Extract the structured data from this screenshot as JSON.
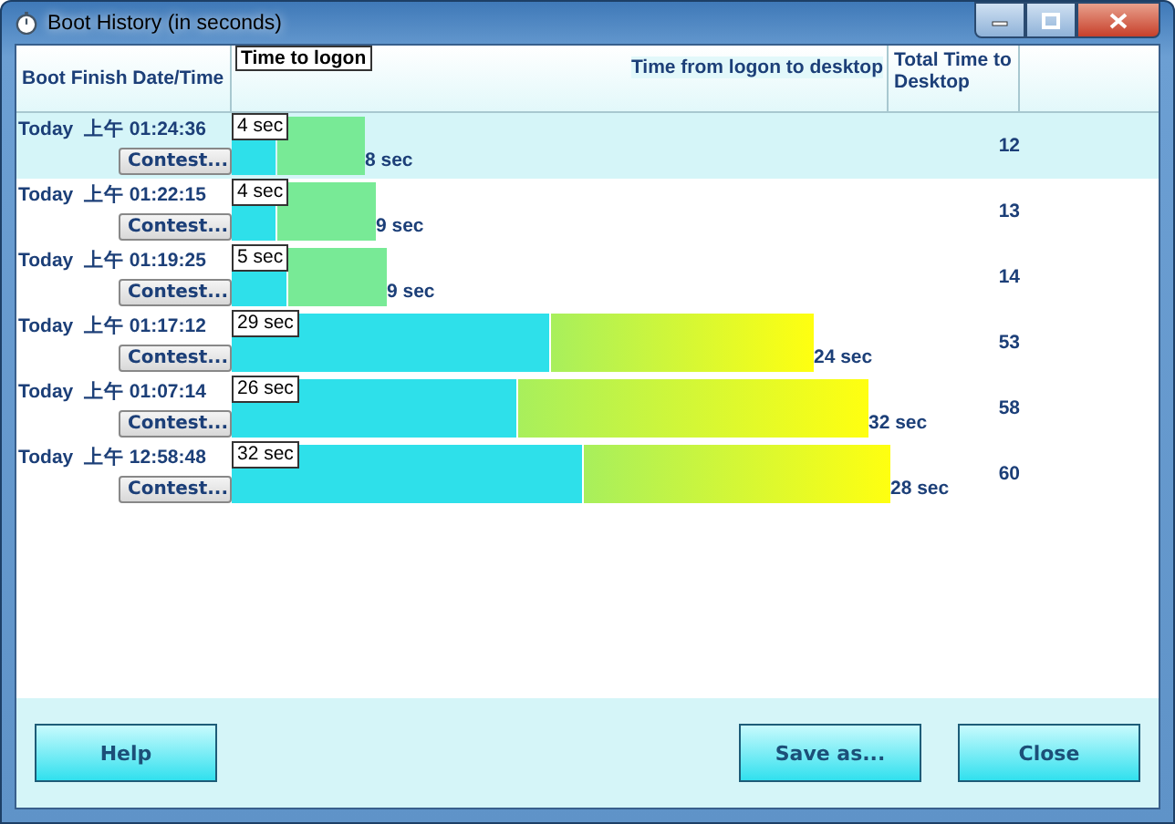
{
  "window": {
    "title": "Boot History (in seconds)"
  },
  "table": {
    "columns": [
      "Boot Finish Date/Time",
      "Time to logon",
      "Time from logon to desktop",
      "Total Time to Desktop"
    ],
    "rows": [
      {
        "date": "Today",
        "period": "上午",
        "time": "01:24:36",
        "button": "Contest...",
        "logon": "4 sec",
        "desktop": "8 sec",
        "total": "12",
        "selected": true
      },
      {
        "date": "Today",
        "period": "上午",
        "time": "01:22:15",
        "button": "Contest...",
        "logon": "4 sec",
        "desktop": "9 sec",
        "total": "13",
        "selected": false
      },
      {
        "date": "Today",
        "period": "上午",
        "time": "01:19:25",
        "button": "Contest...",
        "logon": "5 sec",
        "desktop": "9 sec",
        "total": "14",
        "selected": false
      },
      {
        "date": "Today",
        "period": "上午",
        "time": "01:17:12",
        "button": "Contest...",
        "logon": "29 sec",
        "desktop": "24 sec",
        "total": "53",
        "selected": false
      },
      {
        "date": "Today",
        "period": "上午",
        "time": "01:07:14",
        "button": "Contest...",
        "logon": "26 sec",
        "desktop": "32 sec",
        "total": "58",
        "selected": false
      },
      {
        "date": "Today",
        "period": "上午",
        "time": "12:58:48",
        "button": "Contest...",
        "logon": "32 sec",
        "desktop": "28 sec",
        "total": "60",
        "selected": false
      }
    ]
  },
  "buttons": {
    "left": [
      "Help"
    ],
    "right": [
      "Save as...",
      "Close"
    ]
  }
}
